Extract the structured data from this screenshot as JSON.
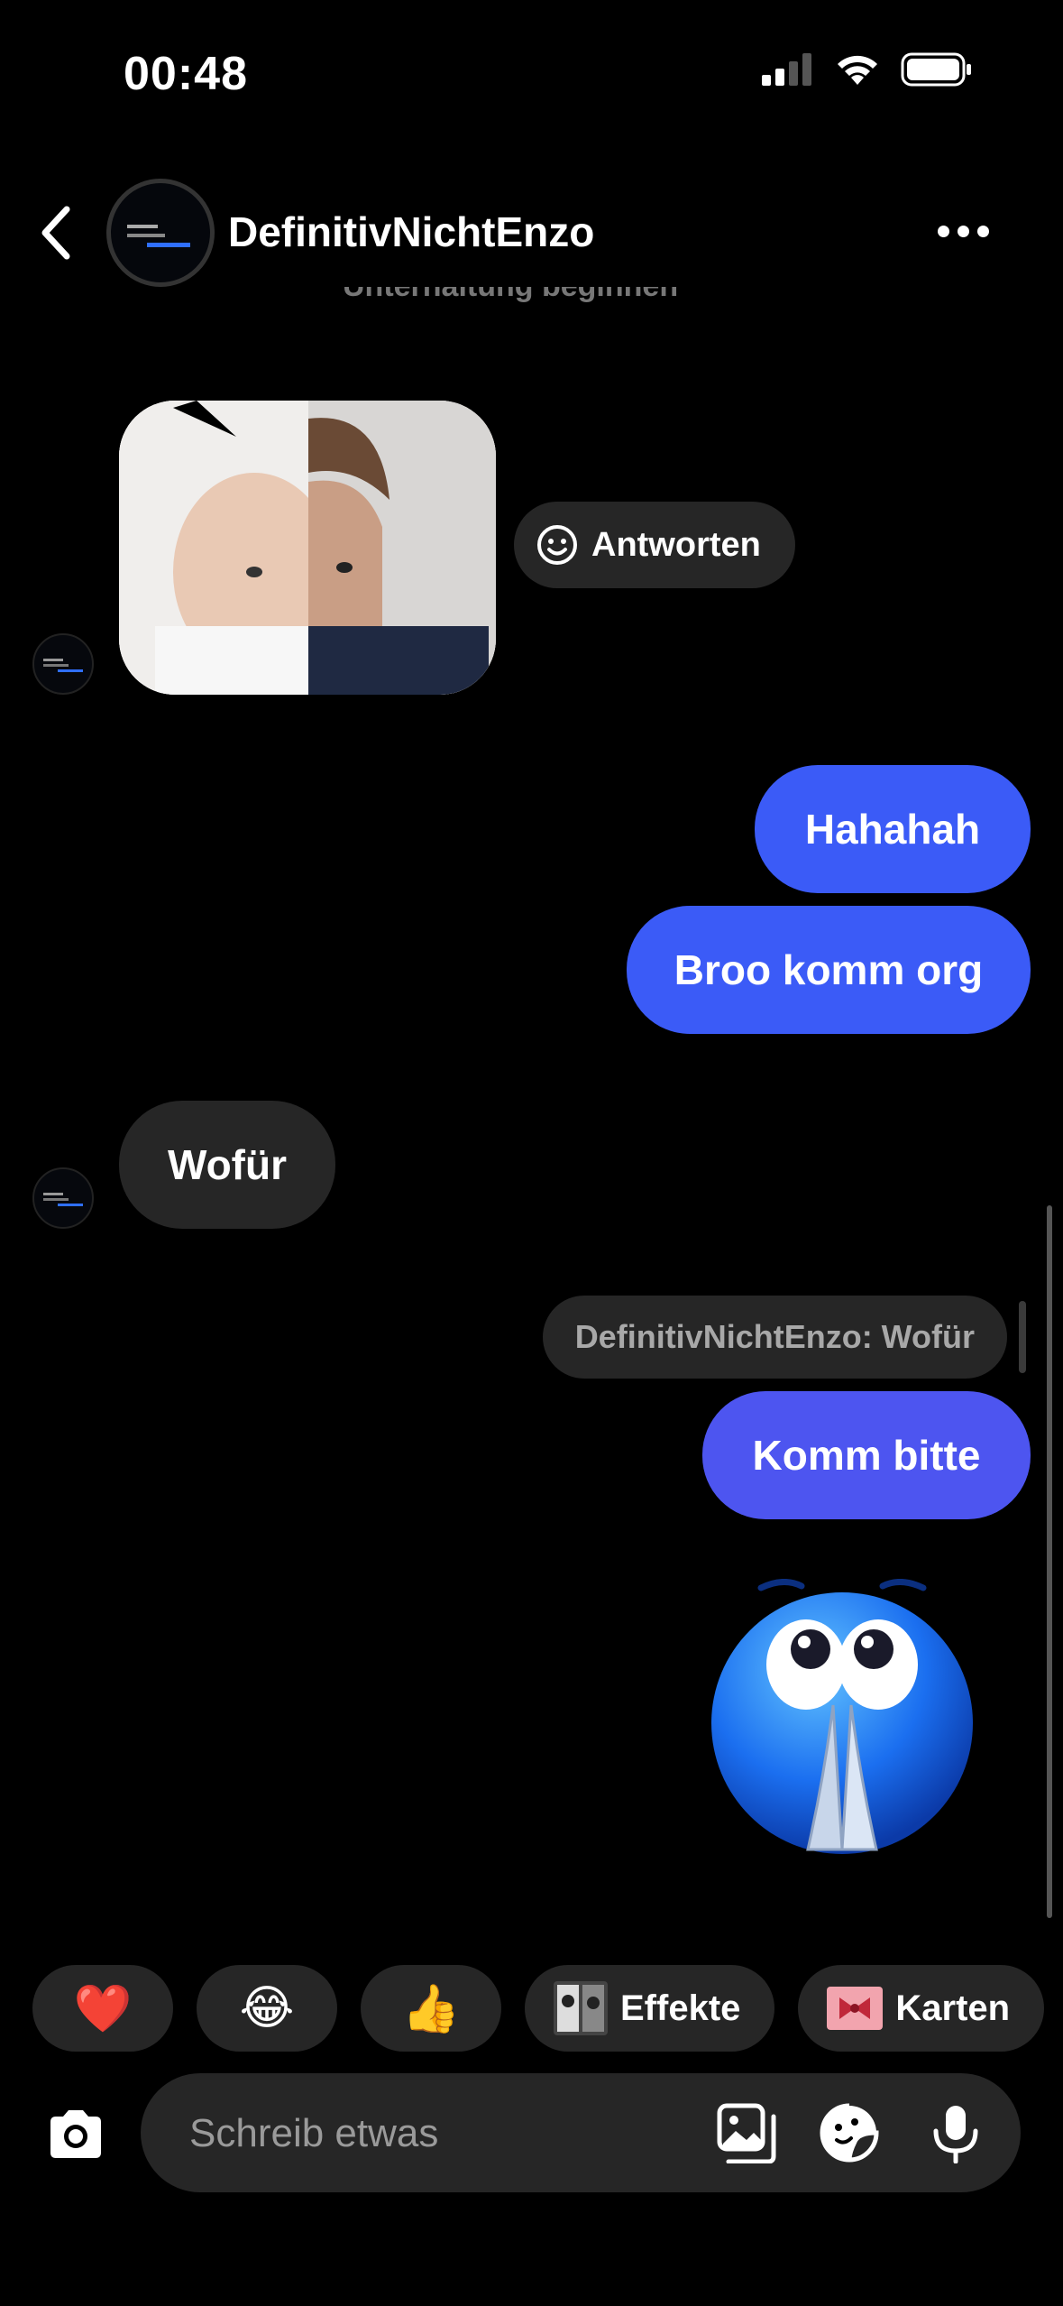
{
  "status_bar": {
    "time": "00:48"
  },
  "header": {
    "title": "DefinitivNichtEnzo",
    "top_hint": "Unterhaltung beginnen"
  },
  "media_message": {
    "reply_label": "Antworten"
  },
  "messages": {
    "out1": "Hahahah",
    "out2": "Broo komm org",
    "in1": "Wofür",
    "reply_quote": "DefinitivNichtEnzo: Wofür",
    "out3": "Komm bitte"
  },
  "quick_actions": {
    "heart": "❤️",
    "laugh": "😂",
    "thumbs": "👍",
    "effects": "Effekte",
    "cards": "Karten"
  },
  "composer": {
    "placeholder": "Schreib etwas"
  },
  "colors": {
    "bubble_out": "#3B5BF7",
    "bubble_in": "#262626",
    "background": "#000000"
  },
  "icons": [
    "back-icon",
    "more-icon",
    "smile-icon",
    "camera-icon",
    "gallery-icon",
    "sticker-icon",
    "mic-icon"
  ]
}
